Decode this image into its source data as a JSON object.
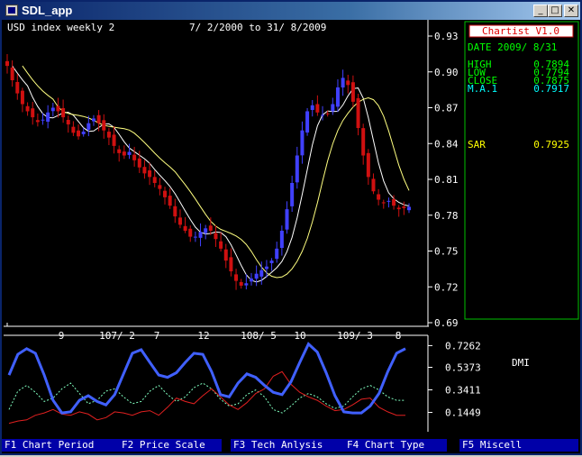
{
  "window": {
    "title": "SDL_app"
  },
  "chart": {
    "symbol": "USD index weekly 2",
    "date_range": "7/ 2/2000 to 31/ 8/2009",
    "price_ticks": [
      "0.93",
      "0.90",
      "0.87",
      "0.84",
      "0.81",
      "0.78",
      "0.75",
      "0.72",
      "0.69"
    ],
    "date_ticks": [
      "9",
      "107/ 2",
      "7",
      "12",
      "108/ 5",
      "10",
      "109/ 3",
      "8"
    ]
  },
  "info_panel": {
    "title": "Chartist V1.0",
    "date": "DATE 2009/ 8/31",
    "quotes": [
      {
        "label": "HIGH",
        "value": "0.7894",
        "color": "#00ff00"
      },
      {
        "label": "LOW",
        "value": "0.7794",
        "color": "#00ff00"
      },
      {
        "label": "CLOSE",
        "value": "0.7875",
        "color": "#00ff00"
      },
      {
        "label": "M.A.1",
        "value": "0.7917",
        "color": "#00ffff"
      }
    ],
    "sar_label": "SAR",
    "sar_value": "0.7925"
  },
  "indicator": {
    "name": "DMI",
    "ticks": [
      "0.7262",
      "0.5373",
      "0.3411",
      "0.1449"
    ]
  },
  "function_keys": [
    {
      "label": "F1 Chart Period"
    },
    {
      "label": "F2 Price Scale"
    },
    {
      "label": "F3 Tech Anlysis"
    },
    {
      "label": "F4 Chart Type"
    },
    {
      "label": "F5 Miscell"
    }
  ],
  "colors": {
    "bull_candle": "#4040ff",
    "bear_candle": "#d01010",
    "ma_fast": "#ffffff",
    "ma_slow": "#ffff80",
    "dmi_adx": "#4060ff",
    "dmi_minus": "#e02020",
    "dmi_plus": "#80ffc0",
    "panel_border": "#00c000"
  },
  "chart_data": {
    "type": "line",
    "price_axis": {
      "min": 0.69,
      "max": 0.93
    },
    "close_series": [
      0.905,
      0.893,
      0.882,
      0.873,
      0.867,
      0.862,
      0.858,
      0.86,
      0.866,
      0.87,
      0.867,
      0.862,
      0.856,
      0.849,
      0.846,
      0.85,
      0.857,
      0.861,
      0.857,
      0.851,
      0.845,
      0.838,
      0.832,
      0.83,
      0.833,
      0.826,
      0.82,
      0.815,
      0.812,
      0.807,
      0.802,
      0.795,
      0.788,
      0.779,
      0.772,
      0.767,
      0.762,
      0.762,
      0.766,
      0.769,
      0.767,
      0.76,
      0.752,
      0.742,
      0.733,
      0.725,
      0.721,
      0.723,
      0.727,
      0.731,
      0.734,
      0.737,
      0.742,
      0.752,
      0.767,
      0.785,
      0.807,
      0.83,
      0.851,
      0.867,
      0.872,
      0.866,
      0.864,
      0.865,
      0.873,
      0.887,
      0.895,
      0.889,
      0.875,
      0.853,
      0.83,
      0.812,
      0.8,
      0.793,
      0.79,
      0.792,
      0.788,
      0.785,
      0.786,
      0.787
    ],
    "dmi_axis": [
      "0.1449",
      "0.3411",
      "0.5373",
      "0.7262"
    ],
    "adx_series": [
      0.47,
      0.65,
      0.7,
      0.66,
      0.47,
      0.25,
      0.14,
      0.15,
      0.25,
      0.29,
      0.24,
      0.21,
      0.3,
      0.48,
      0.66,
      0.69,
      0.58,
      0.47,
      0.45,
      0.49,
      0.58,
      0.66,
      0.65,
      0.5,
      0.3,
      0.28,
      0.4,
      0.48,
      0.45,
      0.38,
      0.32,
      0.3,
      0.41,
      0.58,
      0.74,
      0.67,
      0.49,
      0.29,
      0.15,
      0.14,
      0.14,
      0.2,
      0.31,
      0.5,
      0.66,
      0.7
    ],
    "minus_di_series": [
      0.05,
      0.07,
      0.08,
      0.12,
      0.14,
      0.17,
      0.13,
      0.12,
      0.15,
      0.13,
      0.08,
      0.1,
      0.15,
      0.14,
      0.12,
      0.15,
      0.16,
      0.12,
      0.19,
      0.27,
      0.24,
      0.22,
      0.29,
      0.35,
      0.28,
      0.21,
      0.17,
      0.23,
      0.31,
      0.35,
      0.46,
      0.5,
      0.39,
      0.32,
      0.28,
      0.25,
      0.2,
      0.16,
      0.17,
      0.21,
      0.26,
      0.27,
      0.19,
      0.15,
      0.12,
      0.12
    ],
    "plus_di_series": [
      0.17,
      0.33,
      0.38,
      0.32,
      0.24,
      0.27,
      0.35,
      0.4,
      0.31,
      0.22,
      0.25,
      0.33,
      0.35,
      0.28,
      0.22,
      0.24,
      0.33,
      0.38,
      0.3,
      0.24,
      0.28,
      0.36,
      0.4,
      0.35,
      0.26,
      0.2,
      0.22,
      0.3,
      0.34,
      0.28,
      0.17,
      0.14,
      0.2,
      0.27,
      0.31,
      0.28,
      0.22,
      0.18,
      0.2,
      0.28,
      0.35,
      0.38,
      0.34,
      0.28,
      0.25,
      0.25
    ]
  }
}
